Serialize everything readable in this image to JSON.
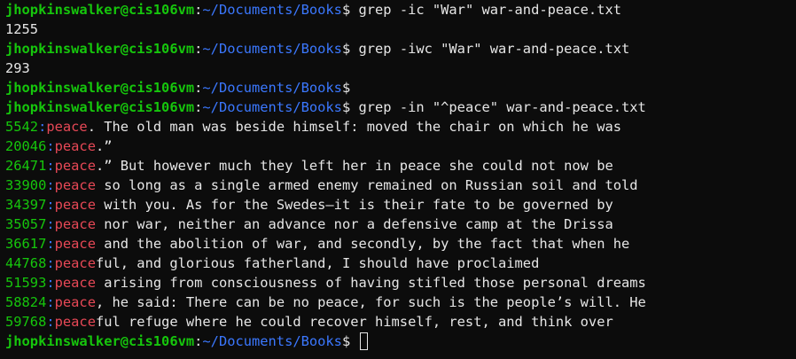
{
  "colors": {
    "background": "#0c0c0c",
    "prompt_user": "#16c60c",
    "prompt_path": "#3b78ff",
    "line_number": "#16c60c",
    "separator": "#3b78ff",
    "match": "#e74856",
    "text": "#e6e6e6"
  },
  "prompt": {
    "user_host": "jhopkinswalker@cis106vm",
    "colon": ":",
    "path": "~/Documents/Books",
    "dollar": "$ "
  },
  "session": [
    {
      "type": "prompt",
      "command": "grep -ic \"War\" war-and-peace.txt"
    },
    {
      "type": "output",
      "text": "1255"
    },
    {
      "type": "prompt",
      "command": "grep -iwc \"War\" war-and-peace.txt"
    },
    {
      "type": "output",
      "text": "293"
    },
    {
      "type": "prompt",
      "command": ""
    },
    {
      "type": "prompt",
      "command": "grep -in \"^peace\" war-and-peace.txt"
    },
    {
      "type": "match",
      "lnum": "5542",
      "sep": ":",
      "match": "peace",
      "rest": ". The old man was beside himself: moved the chair on which he was"
    },
    {
      "type": "match",
      "lnum": "20046",
      "sep": ":",
      "match": "peace",
      "rest": ".”"
    },
    {
      "type": "match",
      "lnum": "26471",
      "sep": ":",
      "match": "peace",
      "rest": ".” But however much they left her in peace she could not now be"
    },
    {
      "type": "match",
      "lnum": "33900",
      "sep": ":",
      "match": "peace",
      "rest": " so long as a single armed enemy remained on Russian soil and told"
    },
    {
      "type": "match",
      "lnum": "34397",
      "sep": ":",
      "match": "peace",
      "rest": " with you. As for the Swedes—it is their fate to be governed by"
    },
    {
      "type": "match",
      "lnum": "35057",
      "sep": ":",
      "match": "peace",
      "rest": " nor war, neither an advance nor a defensive camp at the Drissa"
    },
    {
      "type": "match",
      "lnum": "36617",
      "sep": ":",
      "match": "peace",
      "rest": " and the abolition of war, and secondly, by the fact that when he"
    },
    {
      "type": "match",
      "lnum": "44768",
      "sep": ":",
      "match": "peace",
      "rest": "ful, and glorious fatherland, I should have proclaimed"
    },
    {
      "type": "match",
      "lnum": "51593",
      "sep": ":",
      "match": "peace",
      "rest": " arising from consciousness of having stifled those personal dreams"
    },
    {
      "type": "match",
      "lnum": "58824",
      "sep": ":",
      "match": "peace",
      "rest": ", he said: There can be no peace, for such is the people’s will. He"
    },
    {
      "type": "match",
      "lnum": "59768",
      "sep": ":",
      "match": "peace",
      "rest": "ful refuge where he could recover himself, rest, and think over"
    },
    {
      "type": "prompt",
      "command": "",
      "cursor": true
    }
  ]
}
